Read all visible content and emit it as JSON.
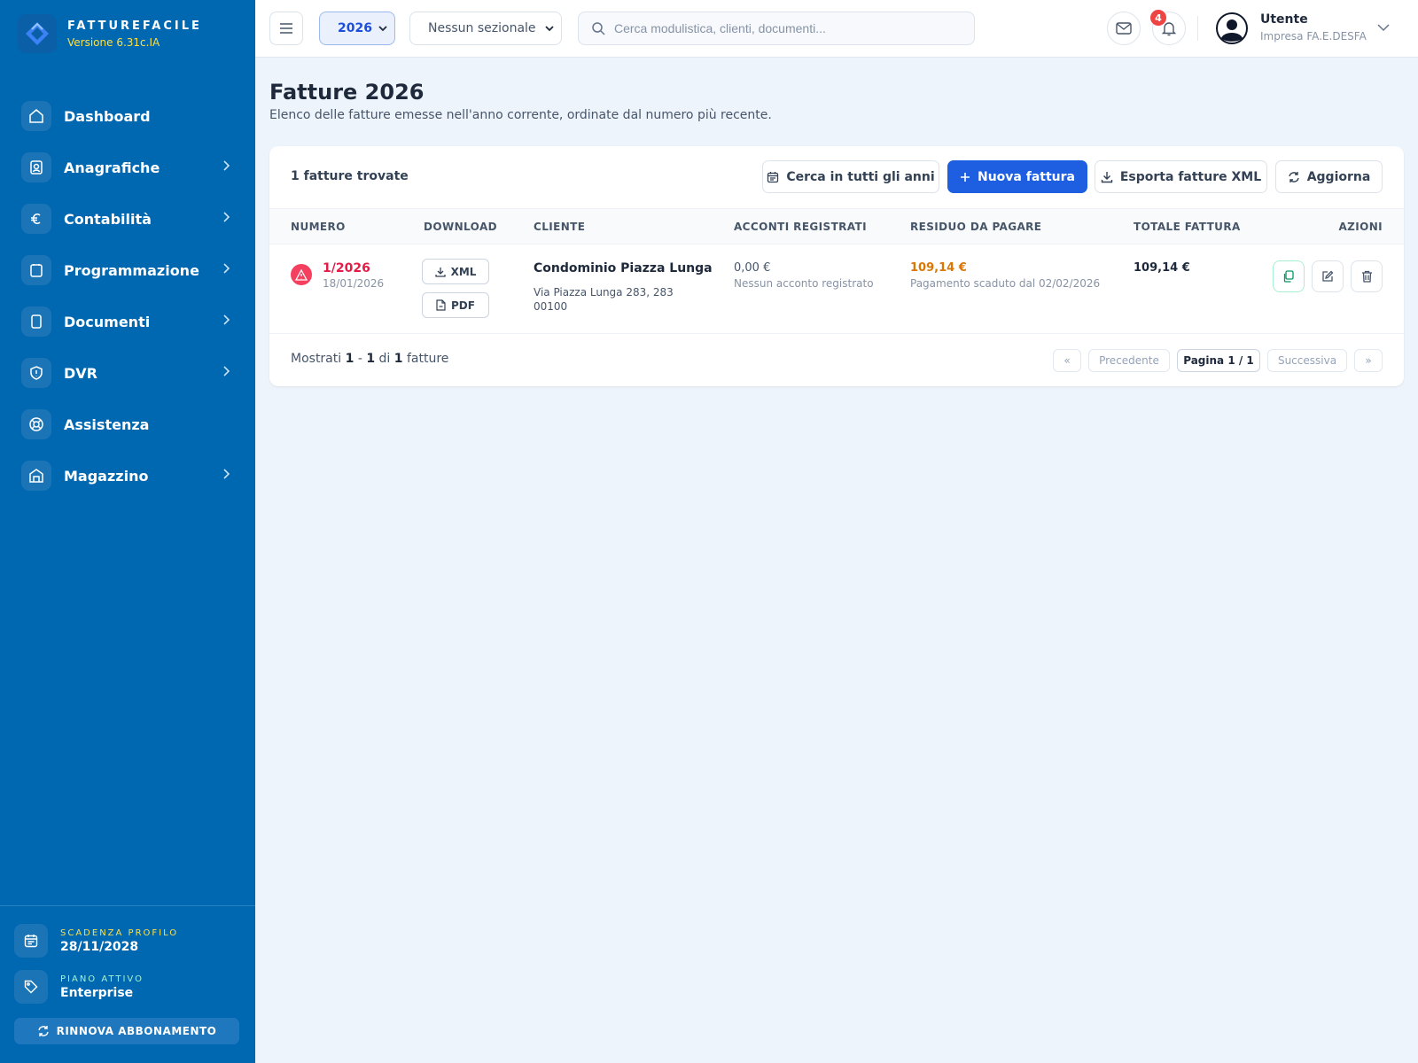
{
  "brand": {
    "name": "FATTUREFACILE",
    "version": "Versione 6.31c.IA"
  },
  "sidebar": {
    "items": [
      {
        "label": "Dashboard",
        "icon": "home-icon",
        "chevron": false
      },
      {
        "label": "Anagrafiche",
        "icon": "contacts-icon",
        "chevron": true
      },
      {
        "label": "Contabilità",
        "icon": "euro-icon",
        "chevron": true
      },
      {
        "label": "Programmazione",
        "icon": "clipboard-icon",
        "chevron": true
      },
      {
        "label": "Documenti",
        "icon": "document-icon",
        "chevron": true
      },
      {
        "label": "DVR",
        "icon": "shield-icon",
        "chevron": true
      },
      {
        "label": "Assistenza",
        "icon": "lifebuoy-icon",
        "chevron": false
      },
      {
        "label": "Magazzino",
        "icon": "warehouse-icon",
        "chevron": true
      }
    ],
    "expiry_caption": "SCADENZA PROFILO",
    "expiry_value": "28/11/2028",
    "plan_caption": "PIANO ATTIVO",
    "plan_value": "Enterprise",
    "renew_label": "RINNOVA ABBONAMENTO"
  },
  "topbar": {
    "year": "2026",
    "sezionale": "Nessun sezionale",
    "search_placeholder": "Cerca modulistica, clienti, documenti...",
    "notifications": "4",
    "user_name": "Utente",
    "user_company": "Impresa FA.E.DESFA"
  },
  "page": {
    "title": "Fatture 2026",
    "subtitle": "Elenco delle fatture emesse nell'anno corrente, ordinate dal numero più recente."
  },
  "toolbar": {
    "count": "1 fatture trovate",
    "search_all_years": "Cerca in tutti gli anni",
    "new_invoice": "Nuova fattura",
    "export_xml": "Esporta fatture XML",
    "refresh": "Aggiorna"
  },
  "table": {
    "columns": [
      "NUMERO",
      "DOWNLOAD",
      "CLIENTE",
      "ACCONTI REGISTRATI",
      "RESIDUO DA PAGARE",
      "TOTALE FATTURA",
      "AZIONI"
    ],
    "rows": [
      {
        "number": "1/2026",
        "date": "18/01/2026",
        "xml_label": "XML",
        "pdf_label": "PDF",
        "client_name": "Condominio Piazza Lunga",
        "client_address": "Via Piazza Lunga 283, 283",
        "client_cap": "00100",
        "acconti": "0,00 €",
        "acconti_note": "Nessun acconto registrato",
        "residuo": "109,14 €",
        "residuo_note": "Pagamento scaduto dal 02/02/2026",
        "totale": "109,14 €"
      }
    ]
  },
  "pagination": {
    "text_prefix": "Mostrati",
    "from": "1",
    "sep": "-",
    "to": "1",
    "of_label": "di",
    "total": "1",
    "suffix": "fatture",
    "first": "«",
    "prev": "Precedente",
    "current": "Pagina 1 / 1",
    "next": "Successiva",
    "last": "»"
  },
  "colors": {
    "sidebar": "#0067b1",
    "primary": "#1d5fe0",
    "danger": "#e11d48",
    "warning": "#d97706",
    "accent_yellow": "#fde047"
  }
}
